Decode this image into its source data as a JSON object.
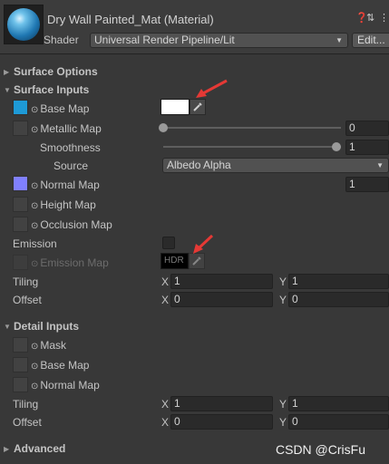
{
  "header": {
    "title": "Dry Wall Painted_Mat (Material)",
    "shader_label": "Shader",
    "shader_value": "Universal Render Pipeline/Lit",
    "edit_button": "Edit...",
    "icons": [
      "help-icon",
      "preset-icon",
      "more-icon"
    ]
  },
  "sections": {
    "surface_options": "Surface Options",
    "surface_inputs": "Surface Inputs",
    "detail_inputs": "Detail Inputs",
    "advanced": "Advanced"
  },
  "surface_inputs": {
    "base_map": "Base Map",
    "base_map_color": "#ffffff",
    "metallic_map": "Metallic Map",
    "metallic_value": "0",
    "metallic_slider": 0,
    "smoothness": "Smoothness",
    "smoothness_value": "1",
    "smoothness_slider": 1,
    "source": "Source",
    "source_value": "Albedo Alpha",
    "normal_map": "Normal Map",
    "normal_value": "1",
    "height_map": "Height Map",
    "occlusion_map": "Occlusion Map",
    "emission": "Emission",
    "emission_map": "Emission Map",
    "hdr_label": "HDR",
    "tiling": "Tiling",
    "tiling_x": "1",
    "tiling_y": "1",
    "offset": "Offset",
    "offset_x": "0",
    "offset_y": "0",
    "x_label": "X",
    "y_label": "Y"
  },
  "detail_inputs": {
    "mask": "Mask",
    "base_map": "Base Map",
    "normal_map": "Normal Map",
    "tiling": "Tiling",
    "tiling_x": "1",
    "tiling_y": "1",
    "offset": "Offset",
    "offset_x": "0",
    "offset_y": "0",
    "x_label": "X",
    "y_label": "Y"
  },
  "watermark": "CSDN @CrisFu",
  "colors": {
    "annotation_arrow": "#e53935",
    "base_map_thumb": "#1e9ad6",
    "normal_map_thumb": "#8080ff"
  }
}
